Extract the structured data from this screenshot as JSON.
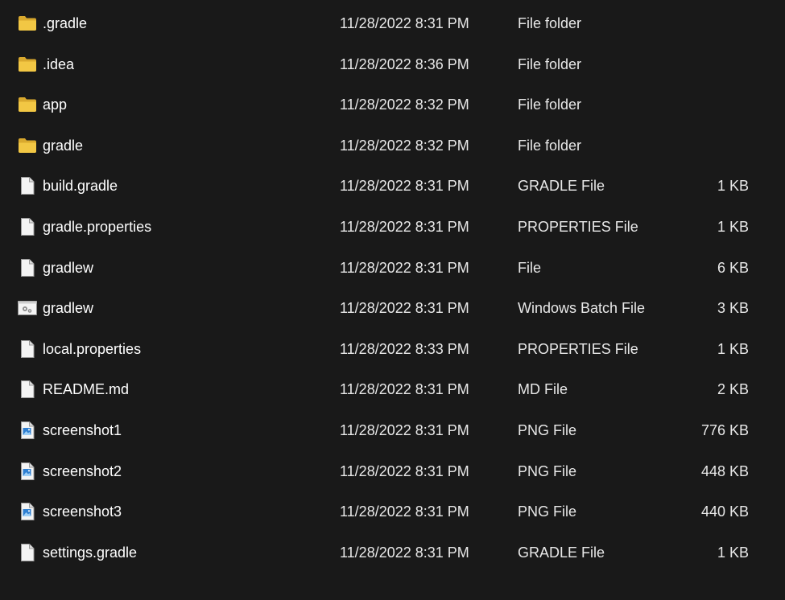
{
  "colors": {
    "background": "#191919",
    "text": "#ffffff",
    "folder": "#f2c744",
    "file": "#f4f4f4",
    "image_accent": "#2f7fd1"
  },
  "files": [
    {
      "name": ".gradle",
      "date": "11/28/2022 8:31 PM",
      "type": "File folder",
      "size": "",
      "icon": "folder-icon"
    },
    {
      "name": ".idea",
      "date": "11/28/2022 8:36 PM",
      "type": "File folder",
      "size": "",
      "icon": "folder-icon"
    },
    {
      "name": "app",
      "date": "11/28/2022 8:32 PM",
      "type": "File folder",
      "size": "",
      "icon": "folder-icon"
    },
    {
      "name": "gradle",
      "date": "11/28/2022 8:32 PM",
      "type": "File folder",
      "size": "",
      "icon": "folder-icon"
    },
    {
      "name": "build.gradle",
      "date": "11/28/2022 8:31 PM",
      "type": "GRADLE File",
      "size": "1 KB",
      "icon": "file-icon"
    },
    {
      "name": "gradle.properties",
      "date": "11/28/2022 8:31 PM",
      "type": "PROPERTIES File",
      "size": "1 KB",
      "icon": "file-icon"
    },
    {
      "name": "gradlew",
      "date": "11/28/2022 8:31 PM",
      "type": "File",
      "size": "6 KB",
      "icon": "file-icon"
    },
    {
      "name": "gradlew",
      "date": "11/28/2022 8:31 PM",
      "type": "Windows Batch File",
      "size": "3 KB",
      "icon": "batch-file-icon"
    },
    {
      "name": "local.properties",
      "date": "11/28/2022 8:33 PM",
      "type": "PROPERTIES File",
      "size": "1 KB",
      "icon": "file-icon"
    },
    {
      "name": "README.md",
      "date": "11/28/2022 8:31 PM",
      "type": "MD File",
      "size": "2 KB",
      "icon": "file-icon"
    },
    {
      "name": "screenshot1",
      "date": "11/28/2022 8:31 PM",
      "type": "PNG File",
      "size": "776 KB",
      "icon": "image-file-icon"
    },
    {
      "name": "screenshot2",
      "date": "11/28/2022 8:31 PM",
      "type": "PNG File",
      "size": "448 KB",
      "icon": "image-file-icon"
    },
    {
      "name": "screenshot3",
      "date": "11/28/2022 8:31 PM",
      "type": "PNG File",
      "size": "440 KB",
      "icon": "image-file-icon"
    },
    {
      "name": "settings.gradle",
      "date": "11/28/2022 8:31 PM",
      "type": "GRADLE File",
      "size": "1 KB",
      "icon": "file-icon"
    }
  ]
}
